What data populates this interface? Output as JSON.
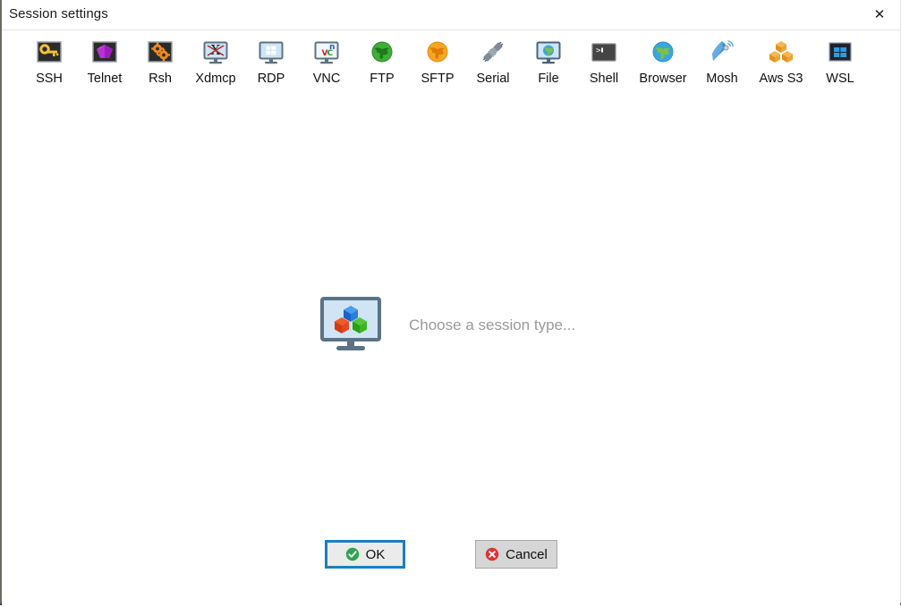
{
  "window": {
    "title": "Session settings",
    "close_label": "✕",
    "close_icon": "close-icon"
  },
  "toolbar": {
    "items": [
      {
        "label": "SSH",
        "icon": "ssh-key-icon"
      },
      {
        "label": "Telnet",
        "icon": "telnet-gem-icon"
      },
      {
        "label": "Rsh",
        "icon": "rsh-gears-icon"
      },
      {
        "label": "Xdmcp",
        "icon": "xdmcp-monitor-icon"
      },
      {
        "label": "RDP",
        "icon": "rdp-monitor-icon"
      },
      {
        "label": "VNC",
        "icon": "vnc-monitor-icon"
      },
      {
        "label": "FTP",
        "icon": "ftp-globe-green-icon"
      },
      {
        "label": "SFTP",
        "icon": "sftp-globe-orange-icon"
      },
      {
        "label": "Serial",
        "icon": "serial-plug-icon"
      },
      {
        "label": "File",
        "icon": "file-monitor-globe-icon"
      },
      {
        "label": "Shell",
        "icon": "shell-terminal-icon"
      },
      {
        "label": "Browser",
        "icon": "browser-globe-icon"
      },
      {
        "label": "Mosh",
        "icon": "mosh-satellite-icon"
      },
      {
        "label": "Aws S3",
        "icon": "aws-s3-cubes-icon"
      },
      {
        "label": "WSL",
        "icon": "wsl-windows-icon"
      }
    ]
  },
  "content": {
    "placeholder_text": "Choose a session type...",
    "placeholder_icon": "session-type-monitor-cubes-icon"
  },
  "footer": {
    "ok_label": "OK",
    "ok_icon": "check-circle-green-icon",
    "cancel_label": "Cancel",
    "cancel_icon": "cross-circle-red-icon"
  },
  "colors": {
    "focus_ring": "#1a7fc1",
    "ok_green": "#2ea44f",
    "cancel_red": "#e03131",
    "placeholder_text": "#9a9a9a",
    "title_text": "#1a1a1a"
  }
}
